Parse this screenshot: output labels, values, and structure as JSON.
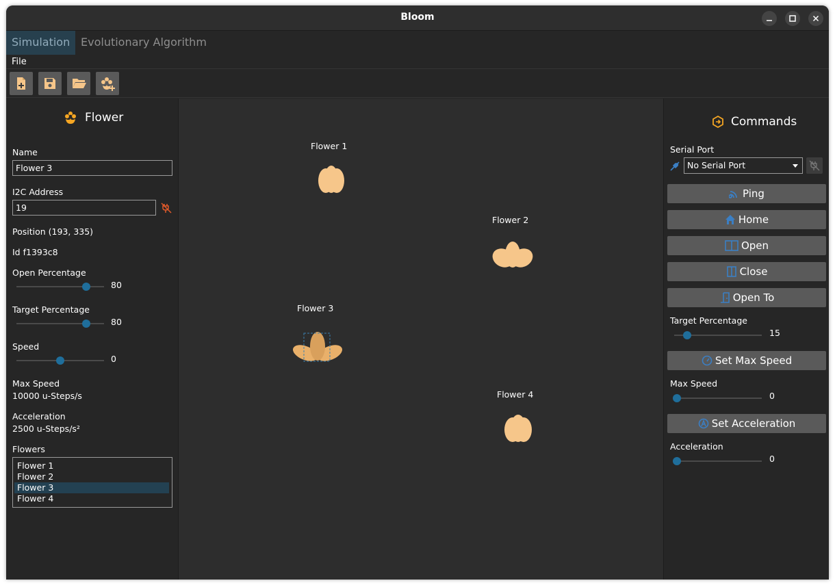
{
  "window": {
    "title": "Bloom"
  },
  "tabs": [
    {
      "label": "Simulation",
      "active": true
    },
    {
      "label": "Evolutionary Algorithm",
      "active": false
    }
  ],
  "menu": {
    "file": "File"
  },
  "toolbar": {
    "buttons": [
      {
        "icon": "new-file-icon"
      },
      {
        "icon": "save-icon"
      },
      {
        "icon": "open-folder-icon"
      },
      {
        "icon": "add-flower-icon"
      }
    ]
  },
  "flower_panel": {
    "title": "Flower",
    "name_label": "Name",
    "name_value": "Flower 3",
    "i2c_label": "I2C Address",
    "i2c_value": "19",
    "position": "Position (193, 335)",
    "id": "Id f1393c8",
    "open_label": "Open Percentage",
    "open_value": "80",
    "open_fraction": 0.8,
    "target_label": "Target Percentage",
    "target_value": "80",
    "target_fraction": 0.8,
    "speed_label": "Speed",
    "speed_value": "0",
    "speed_fraction": 0.5,
    "max_speed_label": "Max Speed",
    "max_speed_value": "10000 u-Steps/s",
    "accel_label": "Acceleration",
    "accel_value": "2500 u-Steps/s²",
    "flowers_label": "Flowers",
    "flowers": [
      "Flower 1",
      "Flower 2",
      "Flower 3",
      "Flower 4"
    ],
    "selected_flower": "Flower 3"
  },
  "canvas": {
    "flowers": [
      {
        "label": "Flower 1"
      },
      {
        "label": "Flower 2"
      },
      {
        "label": "Flower 3"
      },
      {
        "label": "Flower 4"
      }
    ]
  },
  "commands": {
    "title": "Commands",
    "serial_label": "Serial Port",
    "serial_value": "No Serial Port",
    "ping": "Ping",
    "home": "Home",
    "open": "Open",
    "close": "Close",
    "open_to": "Open To",
    "target_label": "Target Percentage",
    "target_value": "15",
    "target_fraction": 0.15,
    "set_max_speed": "Set Max Speed",
    "max_speed_label": "Max Speed",
    "max_speed_value": "0",
    "set_acceleration": "Set Acceleration",
    "accel_label": "Acceleration",
    "accel_value": "0"
  },
  "colors": {
    "accent": "#1f6e9b",
    "flower_petal": "#f6c68a",
    "flower_petal_open": "#e9b06a",
    "icon_orange": "#f5a623",
    "warning_red": "#e45a2a"
  }
}
